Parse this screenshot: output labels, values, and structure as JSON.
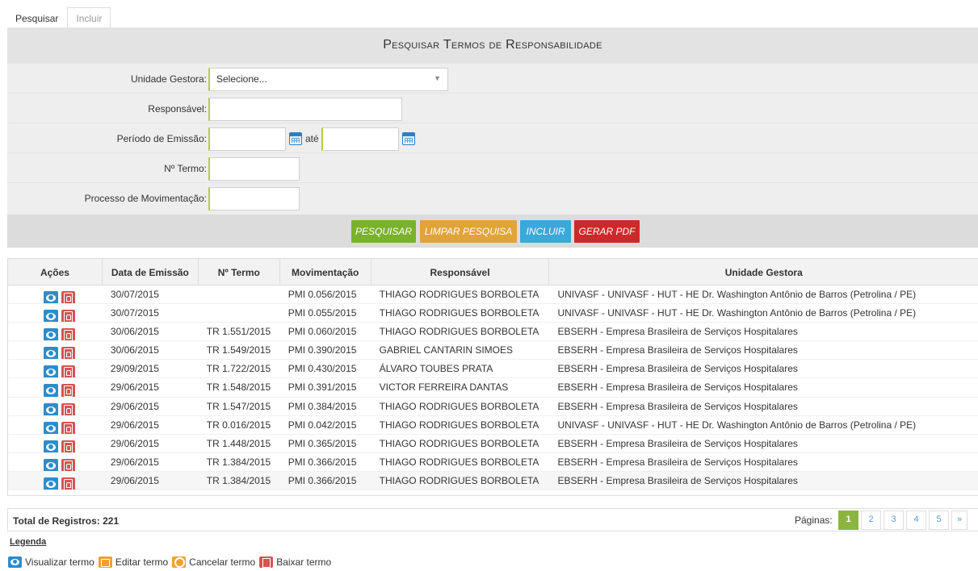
{
  "tabs": [
    {
      "label": "Pesquisar",
      "active": true
    },
    {
      "label": "Incluir",
      "active": false
    }
  ],
  "panel": {
    "title": "Pesquisar Termos de Responsabilidade",
    "fields": {
      "unidade_label": "Unidade Gestora:",
      "unidade_value": "Selecione...",
      "responsavel_label": "Responsável:",
      "responsavel_value": "",
      "periodo_label": "Período de Emissão:",
      "periodo_de": "",
      "periodo_ate_label": "até",
      "periodo_ate": "",
      "termo_label": "Nº Termo:",
      "termo_value": "",
      "processo_label": "Processo de Movimentação:",
      "processo_value": ""
    },
    "buttons": {
      "pesquisar": "Pesquisar",
      "limpar": "Limpar Pesquisa",
      "incluir": "Incluir",
      "gerar_pdf": "Gerar PDF"
    },
    "colors": {
      "pesquisar": "#7ab22b",
      "limpar": "#e0a43a",
      "incluir": "#3aa8d8",
      "gerar_pdf": "#cc2a2a"
    }
  },
  "table": {
    "headers": [
      "Ações",
      "Data de Emissão",
      "Nº Termo",
      "Movimentação",
      "Responsável",
      "Unidade Gestora"
    ],
    "rows": [
      {
        "data": "30/07/2015",
        "termo": "",
        "mov": "PMI 0.056/2015",
        "resp": "THIAGO RODRIGUES BORBOLETA",
        "unidade": "UNIVASF - UNIVASF - HUT - HE Dr. Washington Antônio de Barros (Petrolina / PE)"
      },
      {
        "data": "30/07/2015",
        "termo": "",
        "mov": "PMI 0.055/2015",
        "resp": "THIAGO RODRIGUES BORBOLETA",
        "unidade": "UNIVASF - UNIVASF - HUT - HE Dr. Washington Antônio de Barros (Petrolina / PE)"
      },
      {
        "data": "30/06/2015",
        "termo": "TR 1.551/2015",
        "mov": "PMI 0.060/2015",
        "resp": "THIAGO RODRIGUES BORBOLETA",
        "unidade": "EBSERH - Empresa Brasileira de Serviços Hospitalares"
      },
      {
        "data": "30/06/2015",
        "termo": "TR 1.549/2015",
        "mov": "PMI 0.390/2015",
        "resp": "GABRIEL CANTARIN SIMOES",
        "unidade": "EBSERH - Empresa Brasileira de Serviços Hospitalares"
      },
      {
        "data": "29/09/2015",
        "termo": "TR 1.722/2015",
        "mov": "PMI 0.430/2015",
        "resp": "ÁLVARO TOUBES PRATA",
        "unidade": "EBSERH - Empresa Brasileira de Serviços Hospitalares"
      },
      {
        "data": "29/06/2015",
        "termo": "TR 1.548/2015",
        "mov": "PMI 0.391/2015",
        "resp": "VICTOR FERREIRA DANTAS",
        "unidade": "EBSERH - Empresa Brasileira de Serviços Hospitalares"
      },
      {
        "data": "29/06/2015",
        "termo": "TR 1.547/2015",
        "mov": "PMI 0.384/2015",
        "resp": "THIAGO RODRIGUES BORBOLETA",
        "unidade": "EBSERH - Empresa Brasileira de Serviços Hospitalares"
      },
      {
        "data": "29/06/2015",
        "termo": "TR 0.016/2015",
        "mov": "PMI 0.042/2015",
        "resp": "THIAGO RODRIGUES BORBOLETA",
        "unidade": "UNIVASF - UNIVASF - HUT - HE Dr. Washington Antônio de Barros (Petrolina / PE)"
      },
      {
        "data": "29/06/2015",
        "termo": "TR 1.448/2015",
        "mov": "PMI 0.365/2015",
        "resp": "THIAGO RODRIGUES BORBOLETA",
        "unidade": "EBSERH - Empresa Brasileira de Serviços Hospitalares"
      },
      {
        "data": "29/06/2015",
        "termo": "TR 1.384/2015",
        "mov": "PMI 0.366/2015",
        "resp": "THIAGO RODRIGUES BORBOLETA",
        "unidade": "EBSERH - Empresa Brasileira de Serviços Hospitalares"
      },
      {
        "data": "29/06/2015",
        "termo": "TR 1.384/2015",
        "mov": "PMI 0.366/2015",
        "resp": "THIAGO RODRIGUES BORBOLETA",
        "unidade": "EBSERH - Empresa Brasileira de Serviços Hospitalares"
      }
    ],
    "row_actions": [
      "eye-icon",
      "pdf-icon"
    ]
  },
  "footer": {
    "total": "Total de Registros: 221",
    "paginas_label": "Páginas:",
    "pages": [
      "1",
      "2",
      "3",
      "4",
      "5",
      "»"
    ],
    "current_page": "1"
  },
  "legend": {
    "title": "Legenda",
    "items": [
      {
        "icon": "eye-icon",
        "label": "Visualizar termo"
      },
      {
        "icon": "edit-icon",
        "label": "Editar termo"
      },
      {
        "icon": "cancel-icon",
        "label": "Cancelar termo"
      },
      {
        "icon": "pdf-icon",
        "label": "Baixar termo"
      }
    ]
  }
}
